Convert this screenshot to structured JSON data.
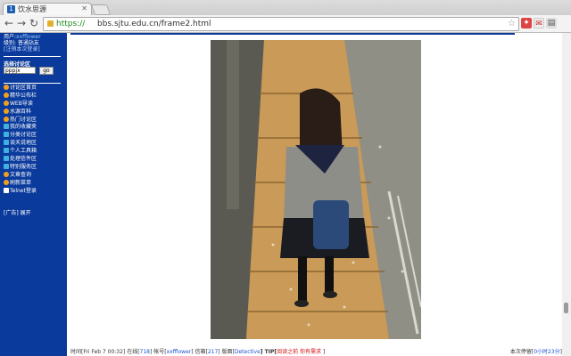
{
  "browser": {
    "tab_title": "饮水思源",
    "favicon_text": "1",
    "url_scheme": "https://",
    "url_rest": "bbs.sjtu.edu.cn/frame2.html"
  },
  "sidebar": {
    "user_label": "用户:",
    "user_name": "xxfflower",
    "level_label": "级别: 普通站友",
    "logout_link": "[注销本次登录]",
    "board_label": "选择讨论区",
    "board_input_value": "pppjx",
    "go_label": "go",
    "menu_items": [
      {
        "label": "讨论区首页",
        "icon": "sun-icon",
        "color": "#f0a020"
      },
      {
        "label": "精华公布栏",
        "icon": "sun-icon",
        "color": "#f0a020"
      },
      {
        "label": "WEB导读",
        "icon": "sun-icon",
        "color": "#f0a020"
      },
      {
        "label": "水源百科",
        "icon": "sun-icon",
        "color": "#f0a020"
      },
      {
        "label": "热门讨论区",
        "icon": "sun-icon",
        "color": "#f0a020"
      },
      {
        "label": "我的收藏夹",
        "icon": "folder-icon",
        "color": "#40b0e0"
      },
      {
        "label": "分类讨论区",
        "icon": "folder-icon",
        "color": "#40b0e0"
      },
      {
        "label": "谈天说地区",
        "icon": "folder-icon",
        "color": "#40b0e0"
      },
      {
        "label": "个人工具箱",
        "icon": "folder-icon",
        "color": "#40b0e0"
      },
      {
        "label": "处理信件区",
        "icon": "folder-icon",
        "color": "#40b0e0"
      },
      {
        "label": "特别服务区",
        "icon": "folder-icon",
        "color": "#40b0e0"
      },
      {
        "label": "文章查询",
        "icon": "sun-icon",
        "color": "#f0a020"
      },
      {
        "label": "刷新菜单",
        "icon": "sun-icon",
        "color": "#f0a020"
      },
      {
        "label": "Telnet登录",
        "icon": "terminal-icon",
        "color": "#ffffff"
      }
    ],
    "ad_label": "[广告]",
    "ad_expand": "展开"
  },
  "status": {
    "time_prefix": "时间[",
    "time": "Fri Feb 7 00:32",
    "online_prefix": "] 在线[",
    "online": "718",
    "account_prefix": "] 帐号[",
    "account": "xxfflower",
    "mail_prefix": "] 信箱[",
    "mail": "217",
    "board_prefix": "] 版面[",
    "board": "Detective",
    "tip_prefix": "] TIP[",
    "tip": "阅读之前 你有需求",
    "tip_suffix": " ]",
    "stay_prefix": "本次停留[",
    "stay": "0小时23分",
    "stay_suffix": "]"
  },
  "colors": {
    "sidebar_bg": "#0a3a9c",
    "link": "#1a4fd0",
    "tip": "#d01010",
    "url_secure": "#1a8a1a"
  }
}
